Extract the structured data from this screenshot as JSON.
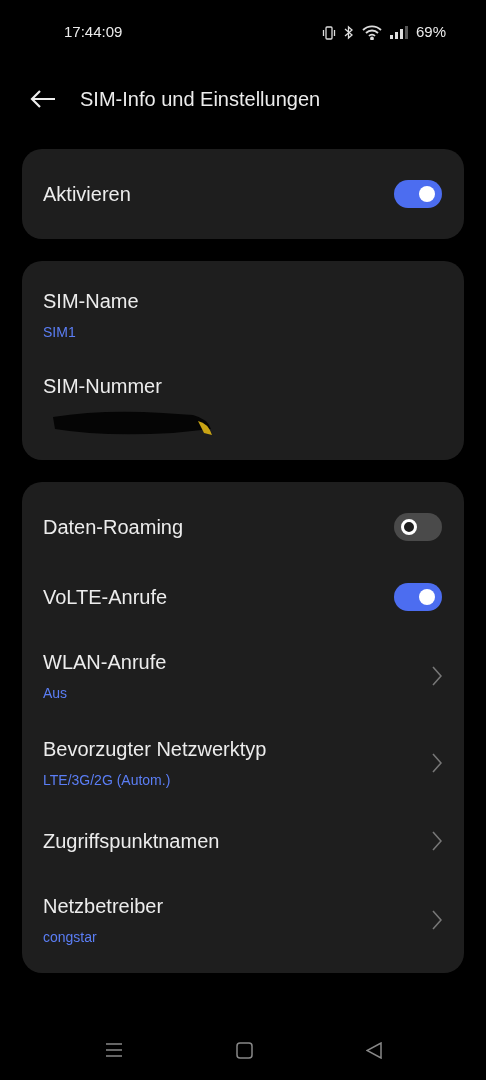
{
  "status_bar": {
    "time": "17:44:09",
    "battery": "69%"
  },
  "header": {
    "title": "SIM-Info und Einstellungen"
  },
  "cards": [
    {
      "rows": [
        {
          "kind": "toggle",
          "label": "Aktivieren",
          "on": true
        }
      ]
    },
    {
      "rows": [
        {
          "kind": "info",
          "label": "SIM-Name",
          "value": "SIM1"
        },
        {
          "kind": "redacted",
          "label": "SIM-Nummer"
        }
      ]
    },
    {
      "rows": [
        {
          "kind": "toggle",
          "label": "Daten-Roaming",
          "on": false
        },
        {
          "kind": "toggle",
          "label": "VoLTE-Anrufe",
          "on": true
        },
        {
          "kind": "link",
          "label": "WLAN-Anrufe",
          "value": "Aus"
        },
        {
          "kind": "link",
          "label": "Bevorzugter Netzwerktyp",
          "value": "LTE/3G/2G (Autom.)"
        },
        {
          "kind": "link",
          "label": "Zugriffspunktnamen"
        },
        {
          "kind": "link",
          "label": "Netzbetreiber",
          "value": "congstar"
        }
      ]
    }
  ]
}
